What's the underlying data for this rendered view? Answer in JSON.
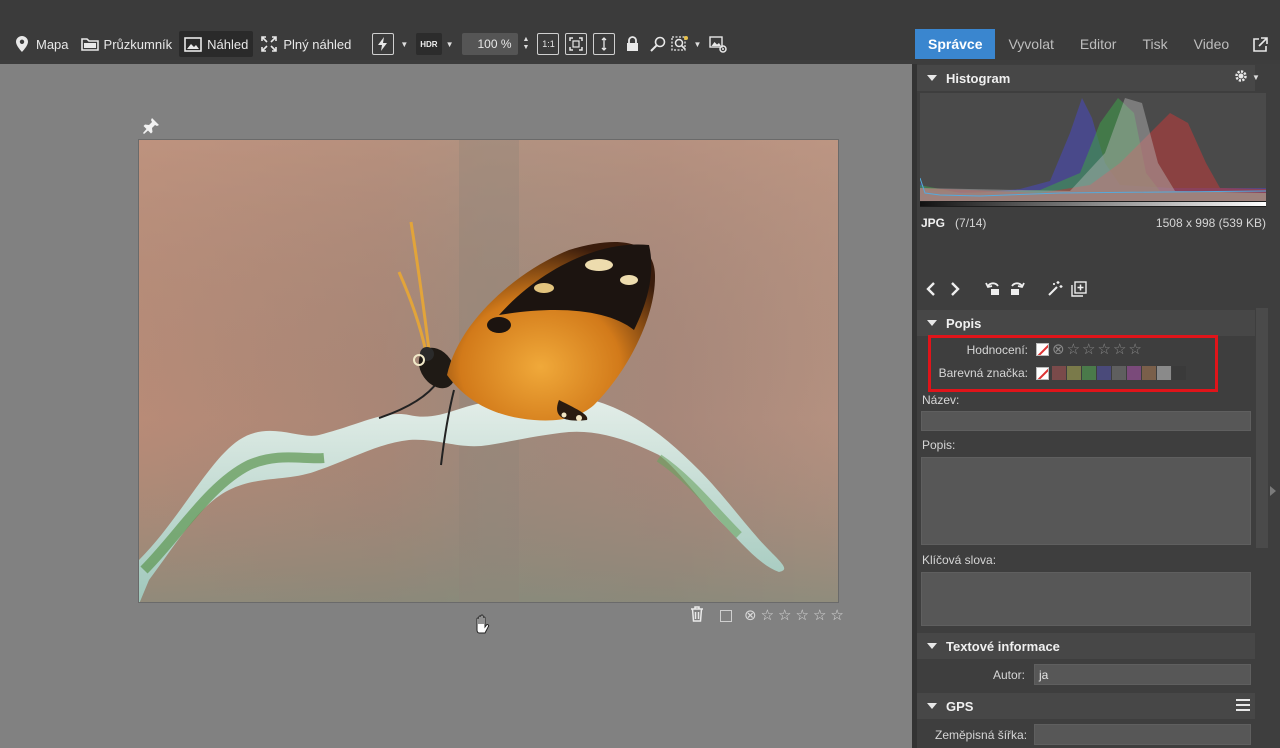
{
  "toolbar": {
    "map_label": "Mapa",
    "explorer_label": "Průzkumník",
    "preview_label": "Náhled",
    "fullview_label": "Plný náhled",
    "hdr_label": "HDR",
    "zoom_value": "100 %",
    "one_to_one_label": "1:1"
  },
  "tabs": [
    {
      "label": "Správce",
      "active": true
    },
    {
      "label": "Vyvolat",
      "active": false
    },
    {
      "label": "Editor",
      "active": false
    },
    {
      "label": "Tisk",
      "active": false
    },
    {
      "label": "Video",
      "active": false
    }
  ],
  "viewer": {
    "rating_stars": 0
  },
  "histogram": {
    "title": "Histogram"
  },
  "file": {
    "format": "JPG",
    "index": "(7/14)",
    "dimensions": "1508 x 998 (539 KB)"
  },
  "popis_section": {
    "title": "Popis",
    "rating_label": "Hodnocení:",
    "color_label": "Barevná značka:",
    "name_label": "Název:",
    "name_value": "",
    "description_label": "Popis:",
    "description_value": "",
    "keywords_label": "Klíčová slova:",
    "keywords_value": "",
    "color_swatches": [
      "#7a4a4a",
      "#7a7a4a",
      "#4a7a4a",
      "#4a4a7a",
      "#5f5f5f",
      "#7a4a7a",
      "#7a5f4a",
      "#8a8a8a",
      "#3a3a3a"
    ]
  },
  "text_info_section": {
    "title": "Textové informace",
    "author_label": "Autor:",
    "author_value": "ja"
  },
  "gps_section": {
    "title": "GPS",
    "latitude_label": "Zeměpisná šířka:",
    "latitude_value": ""
  },
  "colors": {
    "accent": "#3a86cf",
    "highlight": "#e0141a"
  }
}
